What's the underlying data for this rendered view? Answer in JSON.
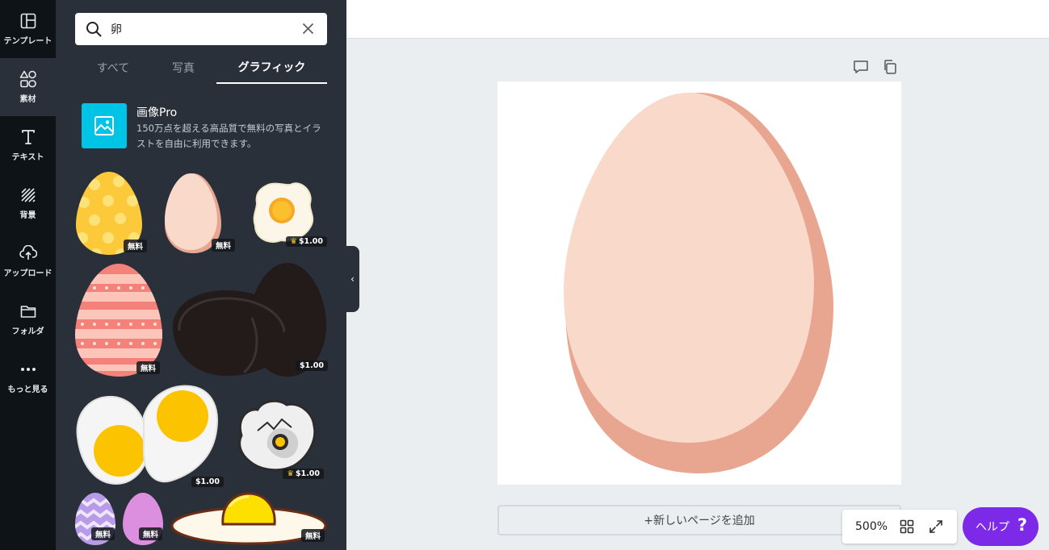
{
  "rail": {
    "items": [
      {
        "label": "テンプレート",
        "icon": "layout-icon"
      },
      {
        "label": "素材",
        "icon": "shapes-icon"
      },
      {
        "label": "テキスト",
        "icon": "text-icon"
      },
      {
        "label": "背景",
        "icon": "background-icon"
      },
      {
        "label": "アップロード",
        "icon": "upload-icon"
      },
      {
        "label": "フォルダ",
        "icon": "folder-icon"
      },
      {
        "label": "もっと見る",
        "icon": "more-icon"
      }
    ]
  },
  "search": {
    "value": "卵",
    "icon": "search-icon"
  },
  "tabs": [
    {
      "label": "すべて"
    },
    {
      "label": "写真"
    },
    {
      "label": "グラフィック",
      "active": true
    }
  ],
  "promo": {
    "title": "画像Pro",
    "desc": "150万点を超える高品質で無料の写真とイラストを自由に利用できます。"
  },
  "grid": {
    "badges": {
      "free": "無料",
      "price": "$1.00"
    }
  },
  "canvas": {
    "add_page": "+新しいページを追加"
  },
  "zoom": {
    "value": "500%"
  },
  "help": {
    "label": "ヘルプ",
    "glyph": "?"
  },
  "colors": {
    "accent": "#7d2ae8",
    "panel": "#293039",
    "rail": "#0e1318",
    "egg_light": "#f9d9c9",
    "egg_shadow": "#e8a690"
  }
}
